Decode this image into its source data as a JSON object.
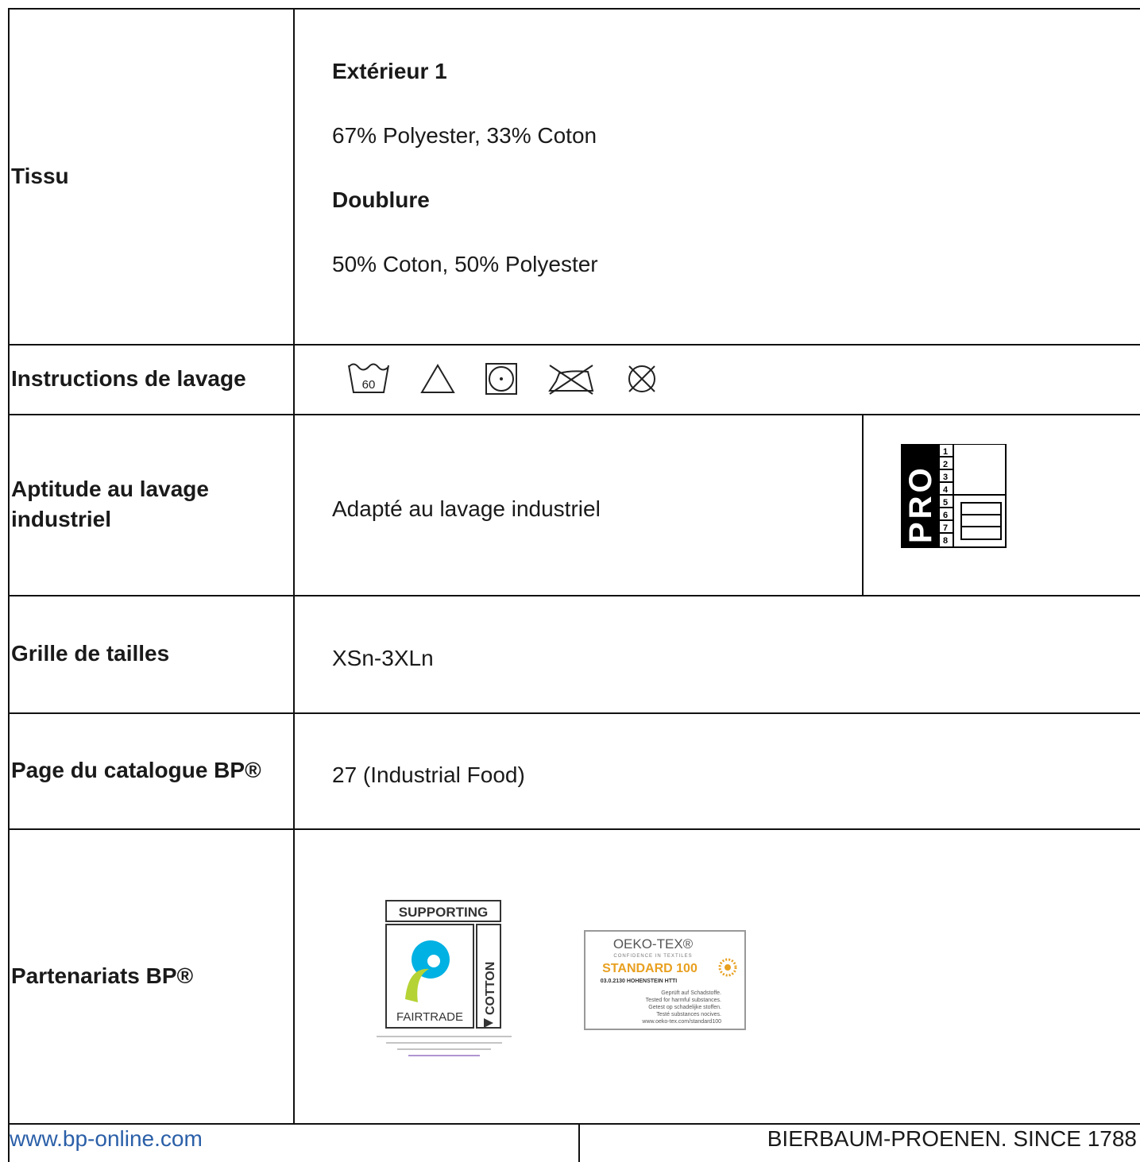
{
  "rows": {
    "tissu": {
      "label": "Tissu",
      "sections": [
        {
          "heading": "Extérieur 1",
          "text": "67% Polyester, 33% Coton"
        },
        {
          "heading": "Doublure",
          "text": "50% Coton, 50% Polyester"
        }
      ]
    },
    "washing": {
      "label": "Instructions de lavage",
      "icons": [
        "wash-60-icon",
        "bleach-triangle-icon",
        "tumble-dry-icon",
        "no-ironing-icon",
        "no-dry-clean-icon"
      ],
      "wash_temp": "60"
    },
    "industrial": {
      "label": "Aptitude au lavage industriel",
      "value": "Adapté au lavage industriel",
      "badge": {
        "text": "PRO",
        "numbers": [
          "1",
          "2",
          "3",
          "4",
          "5",
          "6",
          "7",
          "8"
        ]
      }
    },
    "sizes": {
      "label": "Grille de tailles",
      "value": "XSn-3XLn"
    },
    "catalog": {
      "label": "Page du catalogue BP®",
      "value": "27 (Industrial Food)"
    },
    "partners": {
      "label": "Partenariats BP®",
      "fairtrade": {
        "top": "SUPPORTING",
        "side": "COTTON",
        "bottom": "FAIRTRADE"
      },
      "oekotex": {
        "title": "OEKO-TEX®",
        "tagline": "CONFIDENCE IN TEXTILES",
        "standard": "STANDARD 100",
        "cert": "03.0.2130 HOHENSTEIN HTTI",
        "lines": [
          "Geprüft auf Schadstoffe.",
          "Tested for harmful substances.",
          "Getest op schadelijke stoffen.",
          "Testé substances nocives.",
          "www.oeko-tex.com/standard100"
        ]
      }
    }
  },
  "footer": {
    "left": "www.bp-online.com",
    "right": "BIERBAUM-PROENEN. SINCE 1788"
  },
  "colors": {
    "link": "#2a5fa8",
    "oeko_orange": "#e8a020",
    "fairtrade_blue": "#00b1e3",
    "fairtrade_green": "#b5d334"
  }
}
